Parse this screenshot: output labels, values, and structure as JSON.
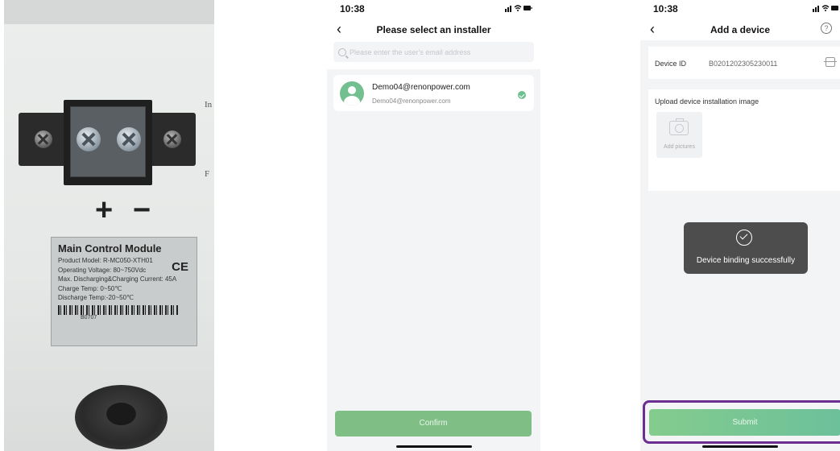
{
  "photo": {
    "edge_texts": [
      "In",
      "F"
    ],
    "polarity_plus": "+",
    "polarity_minus": "−",
    "label": {
      "title": "Main Control Module",
      "lines": [
        "Product Model: R-MC050-XTH01",
        "Operating Voltage: 80~750Vdc",
        "Max. Discharging&Charging Current: 45A",
        "Charge Temp: 0~50℃",
        "Discharge Temp:-20~50℃"
      ],
      "ce_mark": "CE",
      "barcode_text": "B0707"
    }
  },
  "phone1": {
    "status": {
      "time": "10:38",
      "icons": "signal-icon wifi-icon battery-icon"
    },
    "nav": {
      "back_icon": "back-chevron-icon",
      "title": "Please select an installer"
    },
    "search": {
      "placeholder": "Please enter the user's email address",
      "value": ""
    },
    "user": {
      "name": "Demo04@renonpower.com",
      "email": "Demo04@renonpower.com",
      "selected": true,
      "avatar_icon": "user-avatar-icon"
    },
    "confirm_label": "Confirm"
  },
  "phone2": {
    "status": {
      "time": "10:38",
      "icons": "signal-icon wifi-icon battery-icon"
    },
    "nav": {
      "back_icon": "back-chevron-icon",
      "title": "Add a device",
      "help_icon": "help-icon"
    },
    "device": {
      "label": "Device ID",
      "value": "B0201202305230011",
      "scan_icon": "scan-icon"
    },
    "upload": {
      "title": "Upload device installation image",
      "add_label": "Add pictures",
      "camera_icon": "camera-icon"
    },
    "toast": {
      "text": "Device binding successfully",
      "icon": "check-circle-icon"
    },
    "submit_label": "Submit"
  },
  "colors": {
    "accent_green": "#7fbf86",
    "check_green": "#6cc08f",
    "highlight_purple": "#6a2f8f",
    "toast_bg": "#4d4d4d",
    "page_bg": "#f3f4f6"
  }
}
